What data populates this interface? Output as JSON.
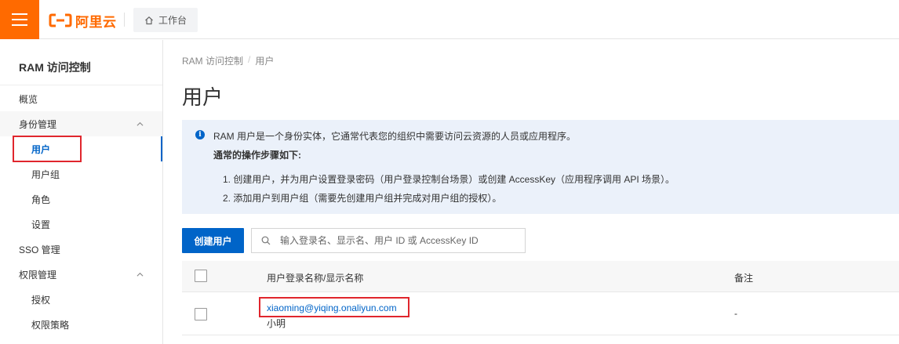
{
  "header": {
    "brand": "阿里云",
    "workbench_label": "工作台",
    "brand_color": "#ff6a00"
  },
  "sidebar": {
    "title": "RAM 访问控制",
    "items": [
      {
        "label": "概览",
        "level": 1
      },
      {
        "label": "身份管理",
        "level": 1,
        "expanded": true
      },
      {
        "label": "用户",
        "level": 2,
        "active": true
      },
      {
        "label": "用户组",
        "level": 2
      },
      {
        "label": "角色",
        "level": 2
      },
      {
        "label": "设置",
        "level": 2
      },
      {
        "label": "SSO 管理",
        "level": 1
      },
      {
        "label": "权限管理",
        "level": 1,
        "expanded": true
      },
      {
        "label": "授权",
        "level": 2
      },
      {
        "label": "权限策略",
        "level": 2
      }
    ]
  },
  "breadcrumb": {
    "root": "RAM 访问控制",
    "separator": "/",
    "current": "用户"
  },
  "page": {
    "title": "用户"
  },
  "info": {
    "line1": "RAM 用户是一个身份实体，它通常代表您的组织中需要访问云资源的人员或应用程序。",
    "line2": "通常的操作步骤如下:",
    "line3": "1. 创建用户，并为用户设置登录密码（用户登录控制台场景）或创建 AccessKey（应用程序调用 API 场景）。",
    "line4": "2. 添加用户到用户组（需要先创建用户组并完成对用户组的授权）。"
  },
  "toolbar": {
    "create_label": "创建用户",
    "search_placeholder": "输入登录名、显示名、用户 ID 或 AccessKey ID"
  },
  "table": {
    "columns": [
      "用户登录名称/显示名称",
      "备注"
    ],
    "rows": [
      {
        "login": "xiaoming@yiqing.onaliyun.com",
        "display": "小明",
        "remark": "-"
      }
    ]
  },
  "colors": {
    "accent": "#0064c8",
    "highlight_box": "#e0262d",
    "info_bg": "#ebf1fa"
  }
}
